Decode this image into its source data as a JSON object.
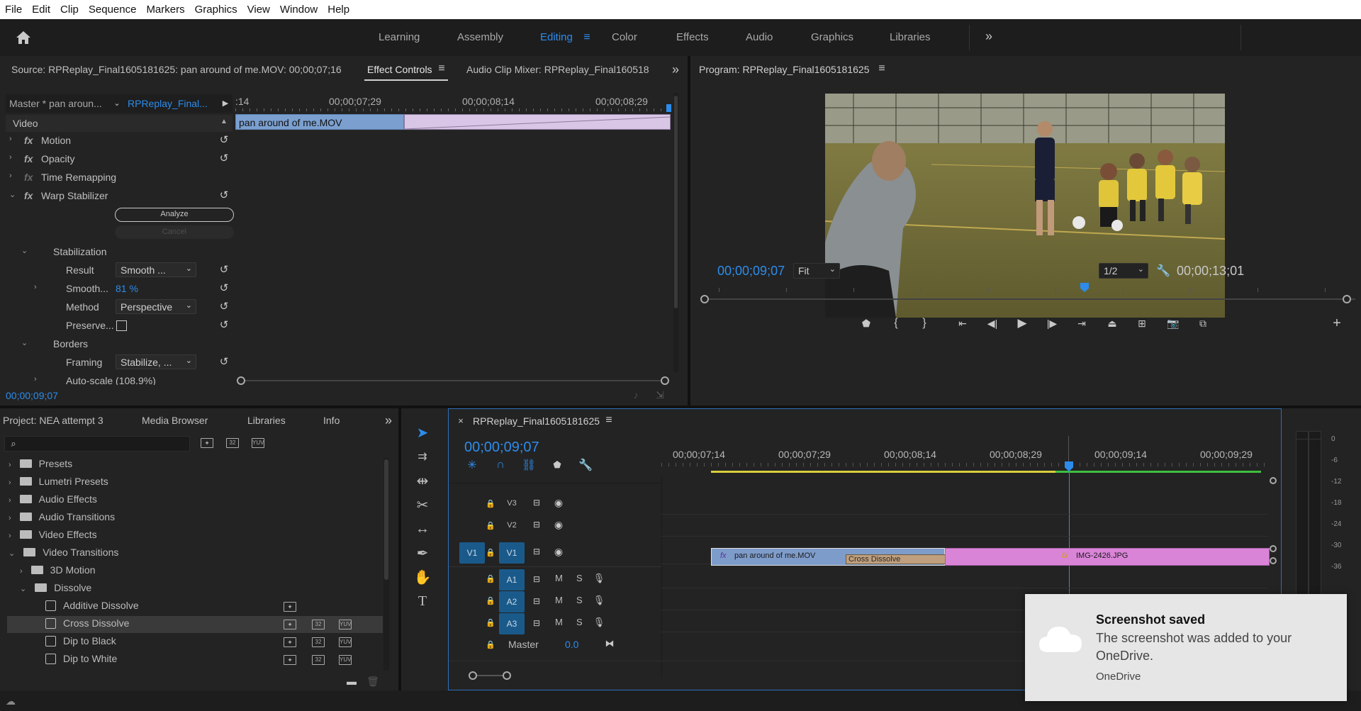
{
  "menu": [
    "File",
    "Edit",
    "Clip",
    "Sequence",
    "Markers",
    "Graphics",
    "View",
    "Window",
    "Help"
  ],
  "workspaces": [
    "Learning",
    "Assembly",
    "Editing",
    "Color",
    "Effects",
    "Audio",
    "Graphics",
    "Libraries"
  ],
  "workspace_active": "Editing",
  "source_panel": {
    "tab_source": "Source: RPReplay_Final1605181625: pan around of me.MOV: 00;00;07;16",
    "tab_effect_controls": "Effect Controls",
    "tab_audio_mixer": "Audio Clip Mixer: RPReplay_Final160518",
    "master_label": "Master * pan aroun...",
    "sequence_label": "RPReplay_Final...",
    "ruler_ticks": [
      ":14",
      "00;00;07;29",
      "00;00;08;14",
      "00;00;08;29"
    ],
    "clip_name": "pan around of me.MOV",
    "current_time": "00;00;09;07",
    "sections": {
      "video": "Video",
      "motion": "Motion",
      "opacity": "Opacity",
      "time_remapping": "Time Remapping",
      "warp_stabilizer": "Warp Stabilizer",
      "analyze_btn": "Analyze",
      "cancel_btn": "Cancel",
      "stabilization": "Stabilization",
      "result_label": "Result",
      "result_value": "Smooth ...",
      "smooth_label": "Smooth...",
      "smooth_value": "81 %",
      "method_label": "Method",
      "method_value": "Perspective",
      "preserve_label": "Preserve...",
      "borders": "Borders",
      "framing_label": "Framing",
      "framing_value": "Stabilize, ...",
      "autoscale_label": "Auto-scale (108.9%)"
    }
  },
  "program_panel": {
    "title": "Program: RPReplay_Final1605181625",
    "current_time": "00;00;09;07",
    "fit": "Fit",
    "resolution": "1/2",
    "duration": "00;00;13;01"
  },
  "project_panel": {
    "tabs": [
      "Project: NEA attempt 3",
      "Media Browser",
      "Libraries",
      "Info"
    ],
    "items": [
      {
        "label": "Presets",
        "level": 0
      },
      {
        "label": "Lumetri Presets",
        "level": 0
      },
      {
        "label": "Audio Effects",
        "level": 0
      },
      {
        "label": "Audio Transitions",
        "level": 0
      },
      {
        "label": "Video Effects",
        "level": 0
      },
      {
        "label": "Video Transitions",
        "level": 0,
        "open": true
      },
      {
        "label": "3D Motion",
        "level": 1
      },
      {
        "label": "Dissolve",
        "level": 1,
        "open": true
      },
      {
        "label": "Additive Dissolve",
        "level": 2
      },
      {
        "label": "Cross Dissolve",
        "level": 2,
        "selected": true
      },
      {
        "label": "Dip to Black",
        "level": 2
      },
      {
        "label": "Dip to White",
        "level": 2
      }
    ]
  },
  "timeline": {
    "title": "RPReplay_Final1605181625",
    "current_time": "00;00;09;07",
    "ruler": [
      "00;00;07;14",
      "00;00;07;29",
      "00;00;08;14",
      "00;00;08;29",
      "00;00;09;14",
      "00;00;09;29"
    ],
    "video_tracks": [
      "V3",
      "V2",
      "V1"
    ],
    "audio_tracks": [
      "A1",
      "A2",
      "A3"
    ],
    "source_patch": "V1",
    "master_label": "Master",
    "master_value": "0.0",
    "m": "M",
    "s": "S",
    "clips": {
      "clip1": "pan around of me.MOV",
      "transition": "Cross Dissolve",
      "clip2": "IMG-2426.JPG"
    }
  },
  "meter_scale": [
    "0",
    "-6",
    "-12",
    "-18",
    "-24",
    "-30",
    "-36"
  ],
  "toast": {
    "title": "Screenshot saved",
    "body": "The screenshot was added to your OneDrive.",
    "source": "OneDrive"
  },
  "colors": {
    "accent": "#2d8ceb",
    "clip_blue": "#6f8fbf",
    "clip_pink": "#d982d8",
    "transition": "#b99a7a"
  }
}
